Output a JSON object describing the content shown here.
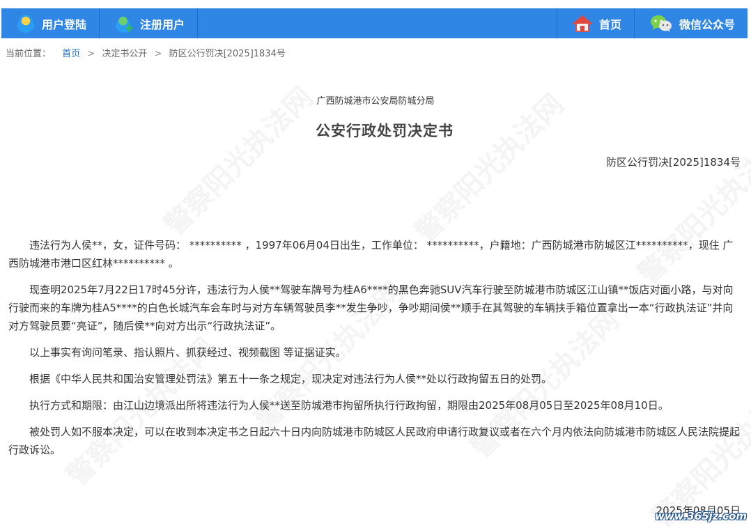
{
  "nav": {
    "login": "用户登陆",
    "register": "注册用户",
    "home": "首页",
    "wechat": "微信公众号"
  },
  "breadcrumb": {
    "label": "当前位置：",
    "home": "首页",
    "section": "决定书公开",
    "current": "防区公行罚决[2025]1834号"
  },
  "document": {
    "issuer": "广西防城港市公安局防城分局",
    "title": "公安行政处罚决定书",
    "number": "防区公行罚决[2025]1834号",
    "paragraphs": [
      "违法行为人侯**，女，证件号码： ********** ，1997年06月04日出生，工作单位： **********，户籍地：广西防城港市防城区江**********，现住 广西防城港市港口区红林**********   。",
      "现查明2025年7月22日17时45分许，违法行为人侯**驾驶车牌号为桂A6****的黑色奔驰SUV汽车行驶至防城港市防城区江山镇**饭店对面小路，与对向行驶而来的车牌为桂A5****的白色长城汽车会车时与对方车辆驾驶员李**发生争吵，争吵期间侯**顺手在其驾驶的车辆扶手箱位置拿出一本“行政执法证”并向对方驾驶员要“亮证”，随后侯**向对方出示“行政执法证”。",
      "以上事实有询问笔录、指认照片、抓获经过、视频截图 等证据证实。",
      "根据《中华人民共和国治安管理处罚法》第五十一条之规定，现决定对违法行为人侯**处以行政拘留五日的处罚。",
      "执行方式和期限：由江山边境派出所将违法行为人侯**送至防城港市拘留所执行行政拘留，期限由2025年08月05日至2025年08月10日。",
      "被处罚人如不服本决定，可以在收到本决定书之日起六十日内向防城港市防城区人民政府申请行政复议或者在六个月内依法向防城港市防城区人民法院提起行政诉讼。"
    ],
    "date": "2025年08月05日"
  },
  "watermark": "警察阳光执法网",
  "site_mark": "www.365jz.com",
  "colors": {
    "nav_bg": "#2f86e4",
    "link": "#1d6fc6"
  },
  "icons": [
    "user-icon",
    "add-user-icon",
    "home-icon",
    "wechat-icon"
  ]
}
